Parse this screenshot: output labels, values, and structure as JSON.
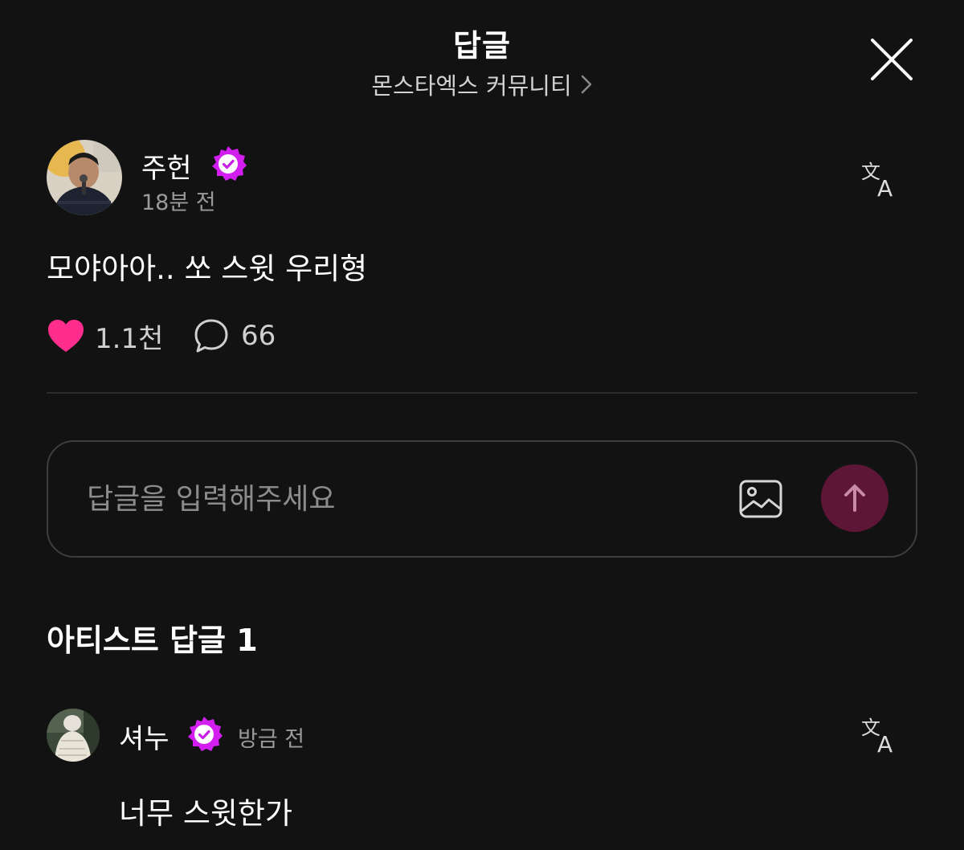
{
  "header": {
    "title": "답글",
    "community_label": "몬스타엑스 커뮤니티",
    "close_icon": "close-icon",
    "chevron_icon": "chevron-right-icon"
  },
  "post": {
    "author": "주헌",
    "verified": true,
    "time": "18분 전",
    "body": "모야아아.. 쏘 스윗 우리형",
    "like_count": "1.1천",
    "comment_count": "66",
    "liked": true,
    "translate_icon": "translate-icon"
  },
  "reply_input": {
    "placeholder": "답글을 입력해주세요",
    "value": "",
    "image_icon": "image-icon",
    "send_icon": "arrow-up-icon"
  },
  "artist_replies": {
    "title": "아티스트 답글 1",
    "items": [
      {
        "author": "셔누",
        "verified": true,
        "time": "방금 전",
        "body": "너무 스윗한가"
      }
    ]
  },
  "colors": {
    "background": "#121212",
    "accent_pink": "#ff2d8e",
    "badge_magenta": "#d21ff0",
    "send_button": "#5e1636",
    "muted_text": "#9a9a9a",
    "divider": "#2c2c2c"
  }
}
